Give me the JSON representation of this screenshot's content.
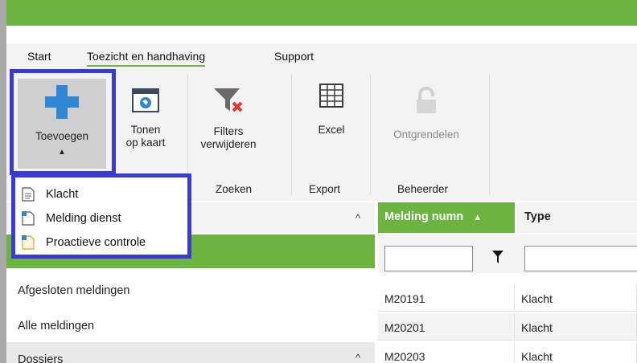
{
  "menu": {
    "items": [
      {
        "label": "Start"
      },
      {
        "label": "Toezicht en handhaving"
      },
      {
        "label": "Support"
      }
    ]
  },
  "ribbon": {
    "add": {
      "label": "Toevoegen",
      "arrow": "▲"
    },
    "map": {
      "line1": "Tonen",
      "line2": "op kaart"
    },
    "filters": {
      "line1": "Filters",
      "line2": "verwijderen"
    },
    "excel": {
      "label": "Excel"
    },
    "unlock": {
      "label": "Ontgrendelen"
    },
    "groups": {
      "search": "Zoeken",
      "export": "Export",
      "admin": "Beheerder"
    }
  },
  "dropdown": {
    "items": [
      {
        "label": "Klacht",
        "icon": "document-icon"
      },
      {
        "label": "Melding dienst",
        "icon": "document-blue-icon"
      },
      {
        "label": "Proactieve controle",
        "icon": "document-orange-icon"
      }
    ]
  },
  "left_panel": {
    "rows": [
      "Afgesloten meldingen",
      "Alle meldingen"
    ],
    "dossiers": "Dossiers"
  },
  "grid": {
    "columns": [
      "Melding numn",
      "Type"
    ],
    "sort_indicator": "▲",
    "rows": [
      {
        "number": "M20191",
        "type": "Klacht"
      },
      {
        "number": "M20201",
        "type": "Klacht"
      },
      {
        "number": "M20203",
        "type": "Klacht"
      }
    ]
  },
  "colors": {
    "accent_green": "#6db33f",
    "highlight_blue": "#3a3ad6"
  }
}
